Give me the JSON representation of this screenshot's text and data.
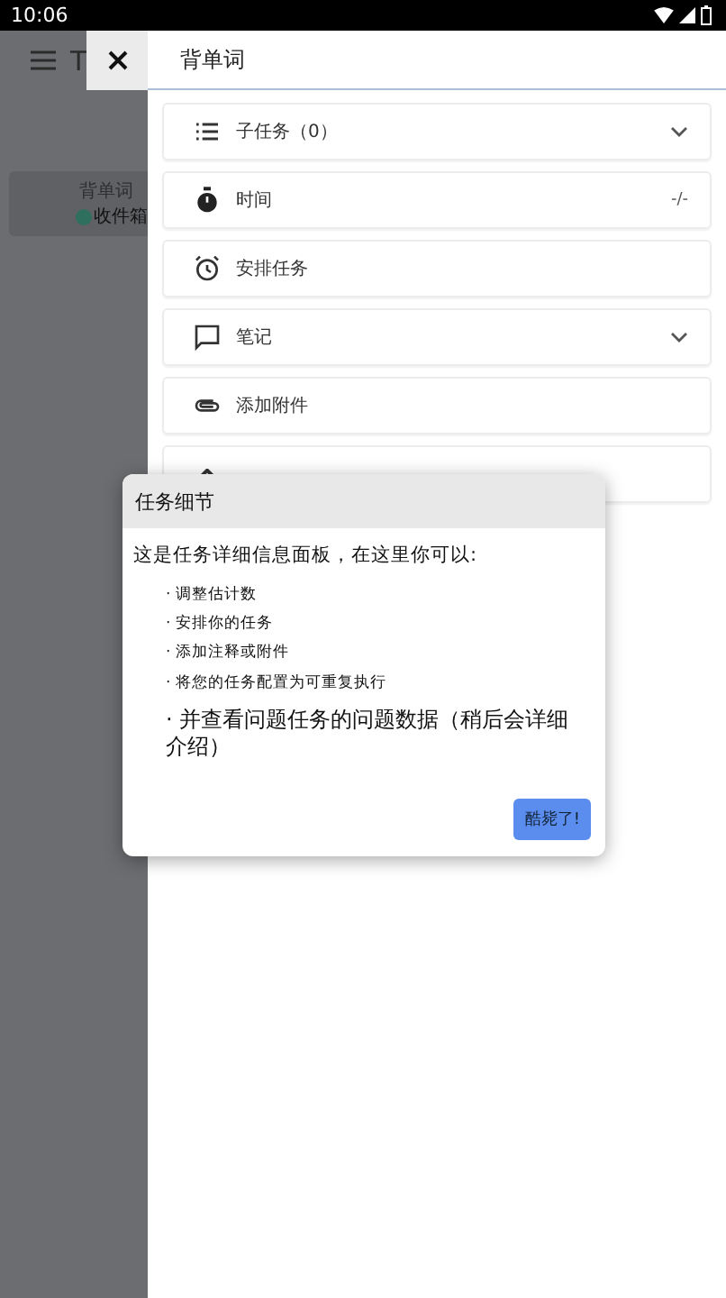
{
  "status_bar": {
    "time": "10:06"
  },
  "background": {
    "title": "T",
    "task": {
      "title": "背单词",
      "list": "收件箱",
      "color": "#2f6f5e"
    }
  },
  "panel": {
    "title": "背单词",
    "sections": [
      {
        "kind": "subtasks",
        "label": "子任务（0）",
        "expandable": true
      },
      {
        "kind": "time",
        "label": "时间",
        "value": "-/-"
      },
      {
        "kind": "schedule",
        "label": "安排任务"
      },
      {
        "kind": "notes",
        "label": "笔记",
        "expandable": true
      },
      {
        "kind": "attachment",
        "label": "添加附件"
      },
      {
        "kind": "repeat"
      }
    ]
  },
  "dialog": {
    "title": "任务细节",
    "intro": "这是任务详细信息面板，在这里你可以:",
    "items": [
      {
        "kind": "small",
        "text": "· 调整估计数"
      },
      {
        "kind": "small",
        "text": "· 安排你的任务"
      },
      {
        "kind": "small",
        "text": "· 添加注释或附件"
      },
      {
        "kind": "small",
        "text": "· 将您的任务配置为可重复执行"
      },
      {
        "kind": "large",
        "text": "· 并查看问题任务的问题数据（稍后会详细介绍）"
      }
    ],
    "button": "酷毙了!"
  }
}
